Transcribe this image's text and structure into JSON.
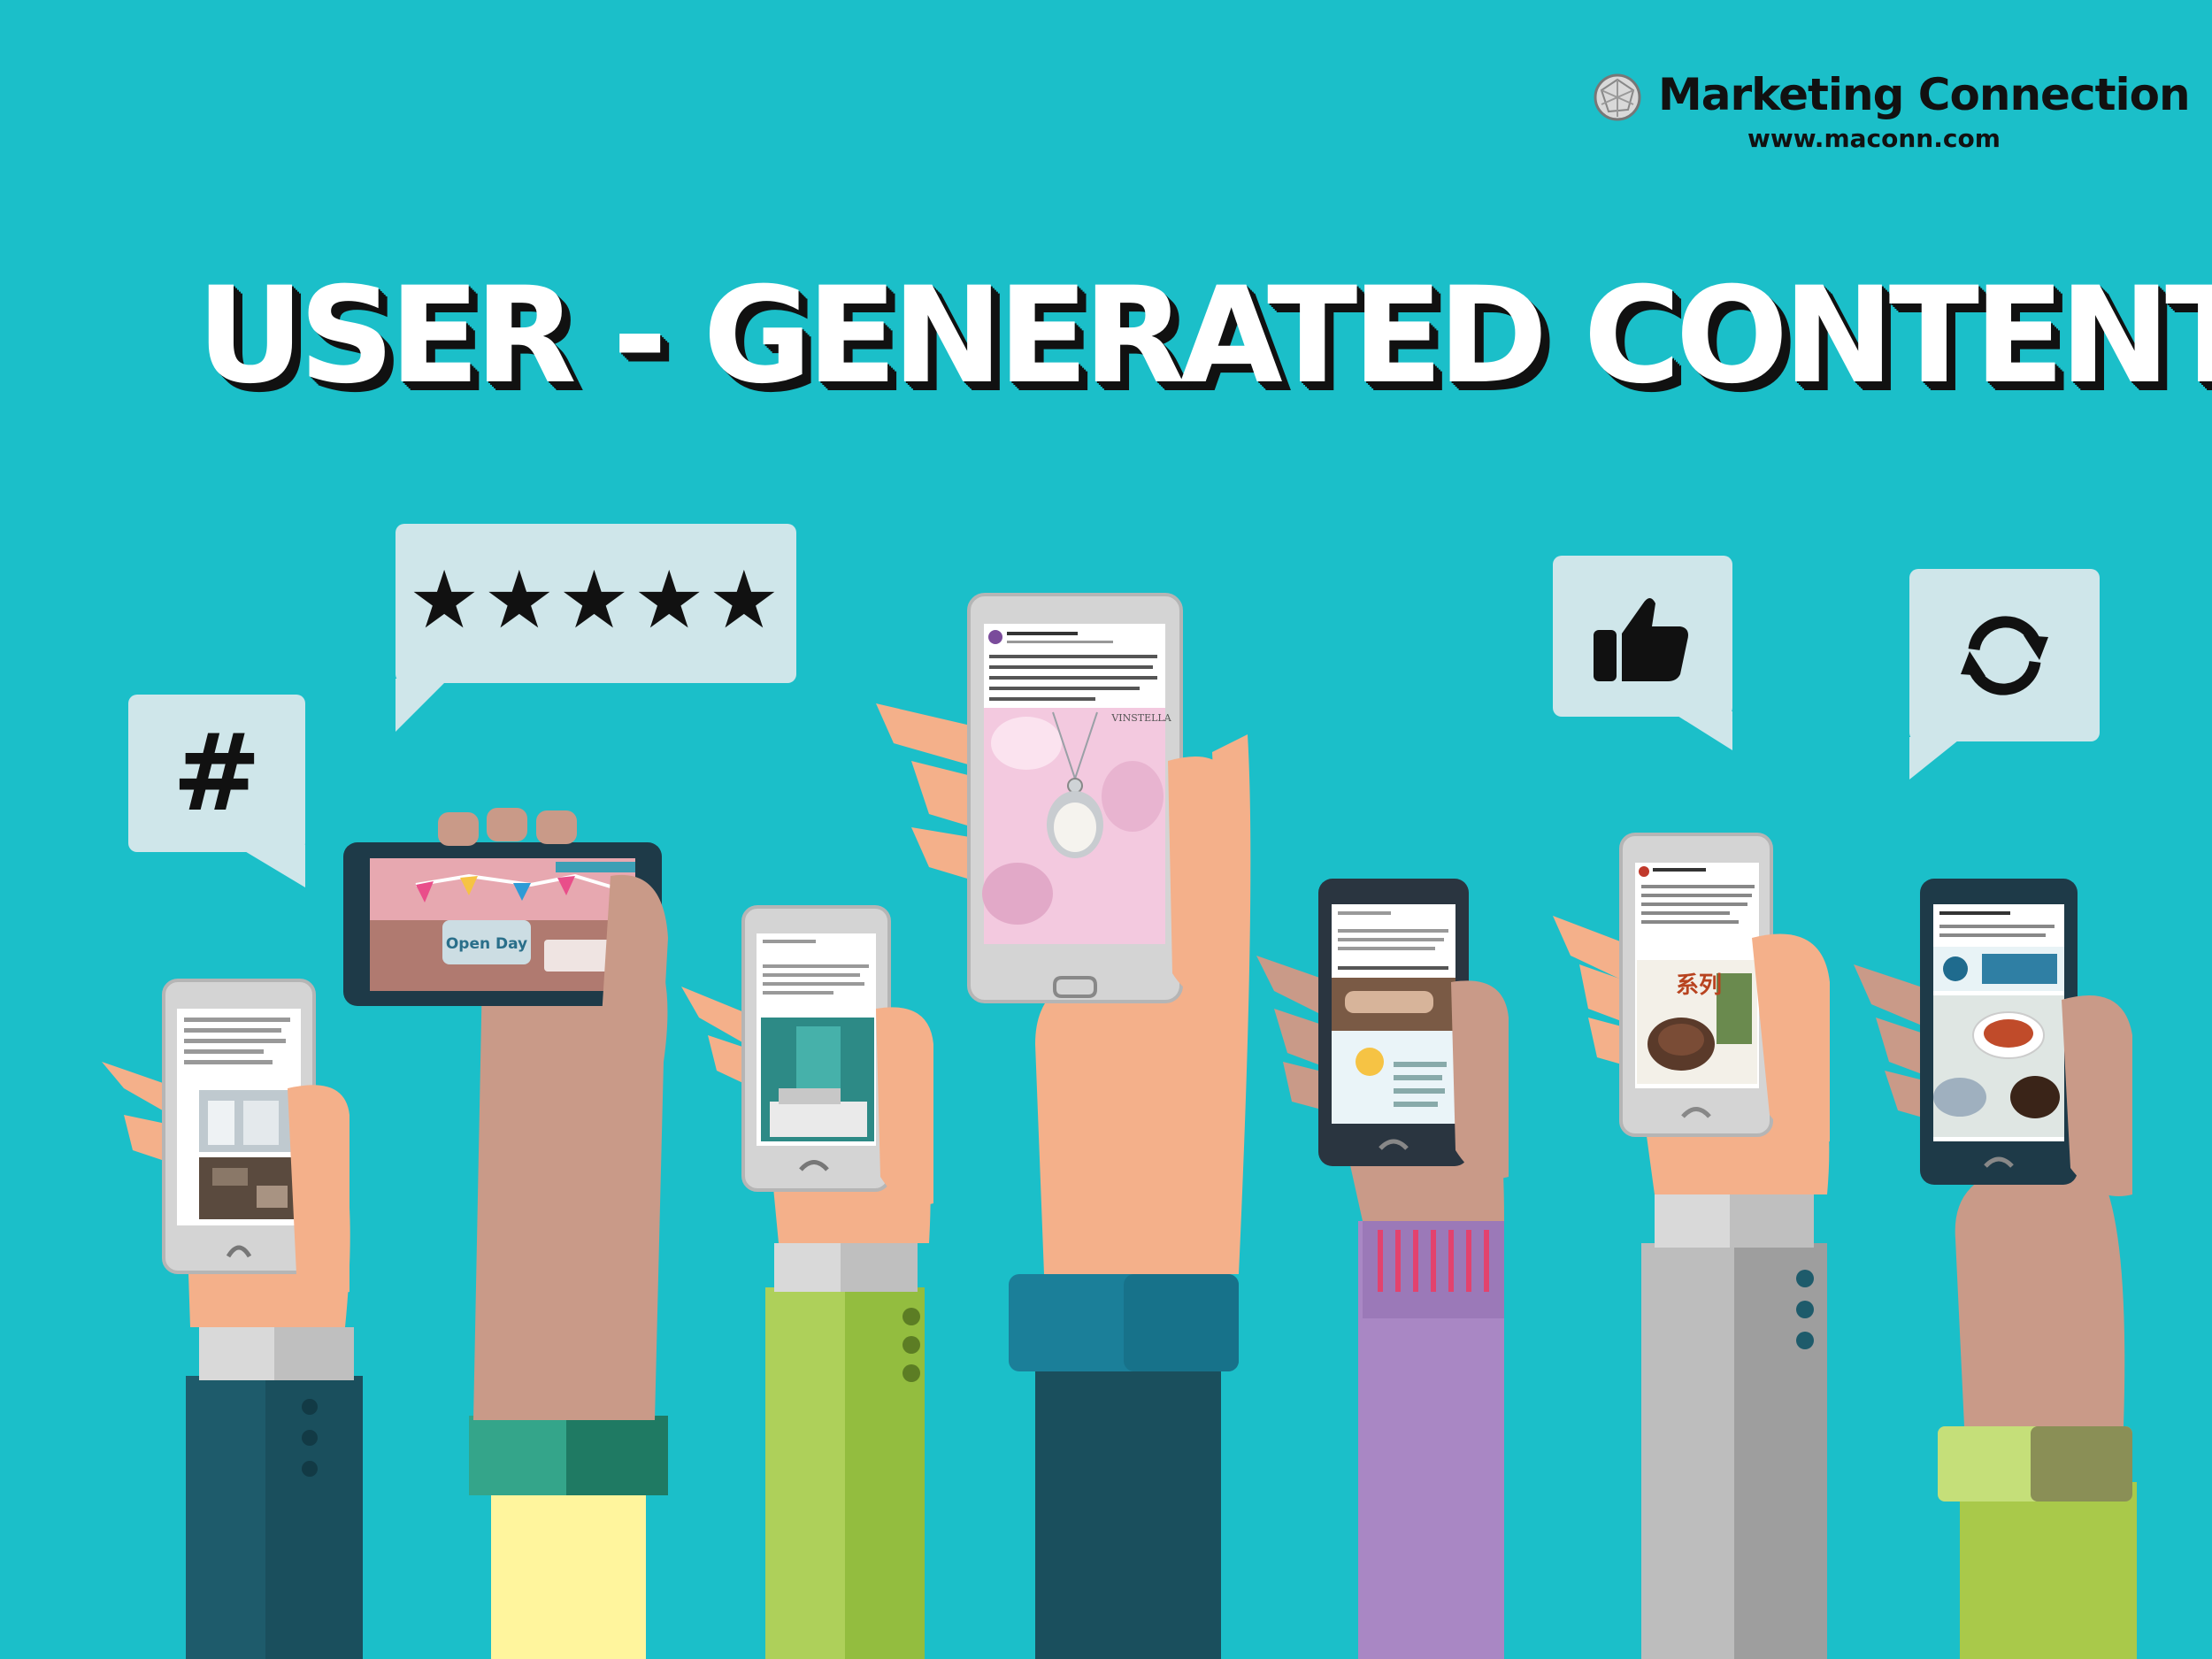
{
  "brand": {
    "name": "Marketing Connection",
    "url": "www.maconn.com",
    "logo_icon": "globe-icon"
  },
  "headline": "USER - GENERATED CONTENT",
  "bubbles": {
    "hashtag": {
      "symbol": "#",
      "icon": "hashtag-icon"
    },
    "rating": {
      "symbol": "★★★★★",
      "icon": "five-star-rating-icon",
      "stars": 5
    },
    "like": {
      "icon": "thumbs-up-icon"
    },
    "share": {
      "icon": "refresh-icon"
    }
  },
  "screens": {
    "landscape": {
      "banner_title": "Open Day"
    },
    "jewelry": {
      "brand_mark": "VINSTELLA"
    },
    "food": {
      "caption": "系列"
    }
  },
  "colors": {
    "background": "#1bbfc9",
    "bubble": "#cfe6ea",
    "skin_light": "#f4b08a",
    "skin_dark": "#c99a88"
  }
}
